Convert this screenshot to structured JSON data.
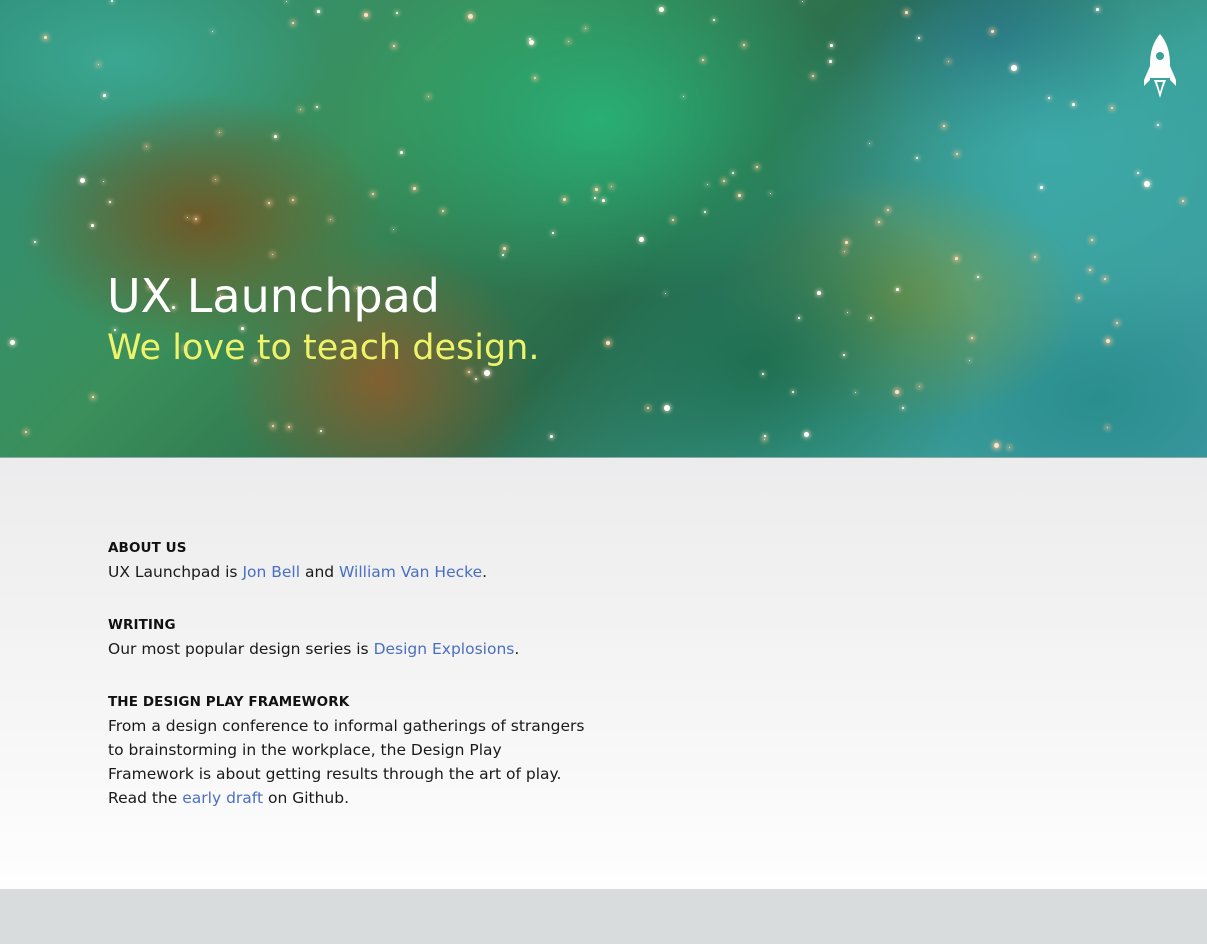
{
  "hero": {
    "title": "UX Launchpad",
    "tagline": "We love to teach design.",
    "logo_icon": "rocket-icon",
    "tagline_color": "#eef36a"
  },
  "sections": {
    "about": {
      "heading": "ABOUT US",
      "text_before": "UX Launchpad is ",
      "link1": "Jon Bell",
      "text_middle": " and ",
      "link2": "William Van Hecke",
      "text_after": "."
    },
    "writing": {
      "heading": "WRITING",
      "text_before": "Our most popular design series is ",
      "link": "Design Explosions",
      "text_after": "."
    },
    "framework": {
      "heading": "THE DESIGN PLAY FRAMEWORK",
      "text_before": "From a design conference to informal gatherings of strangers to brainstorming in the workplace, the Design Play Framework is about getting results through the art of play. Read the ",
      "link": "early draft",
      "text_after": " on Github."
    }
  },
  "colors": {
    "link": "#4a6fc2",
    "footer": "#d9dcdc"
  }
}
